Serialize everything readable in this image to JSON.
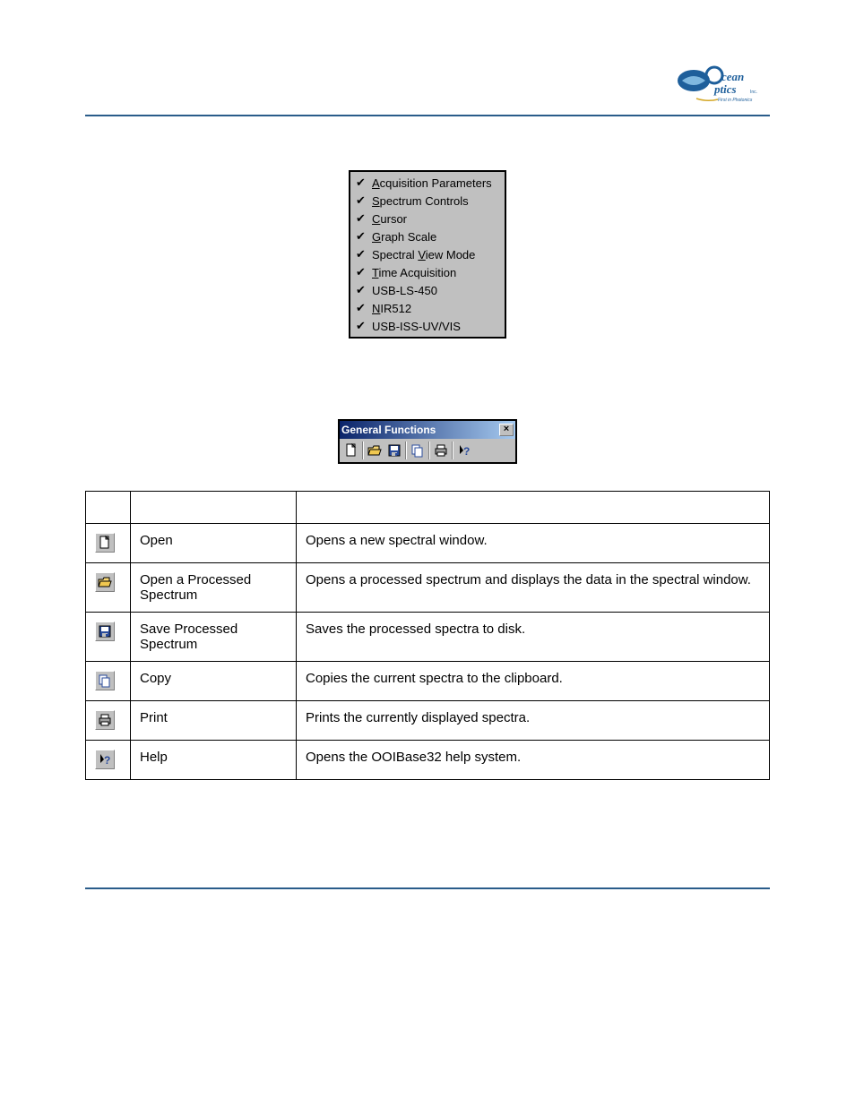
{
  "menu": {
    "items": [
      {
        "prefix": "A",
        "rest": "cquisition Parameters"
      },
      {
        "prefix": "S",
        "rest": "pectrum Controls"
      },
      {
        "prefix": "C",
        "rest": "ursor"
      },
      {
        "prefix": "G",
        "rest": "raph Scale"
      },
      {
        "prefix": "",
        "rest": "Spectral ",
        "mid_u": "V",
        "tail": "iew Mode"
      },
      {
        "prefix": "T",
        "rest": "ime Acquisition"
      },
      {
        "prefix": "",
        "rest": "USB-LS-450"
      },
      {
        "prefix": "N",
        "rest": "IR512"
      },
      {
        "prefix": "",
        "rest": "USB-ISS-UV/VIS"
      }
    ]
  },
  "toolbar": {
    "title": "General Functions"
  },
  "table": {
    "rows": [
      {
        "name": "Open",
        "desc": "Opens a new spectral window."
      },
      {
        "name": "Open a Processed Spectrum",
        "desc": "Opens a processed spectrum and displays the data in the spectral window."
      },
      {
        "name": "Save Processed Spectrum",
        "desc": "Saves the processed spectra to disk."
      },
      {
        "name": "Copy",
        "desc": "Copies the current spectra to the clipboard."
      },
      {
        "name": "Print",
        "desc": "Prints the currently displayed spectra."
      },
      {
        "name": "Help",
        "desc": "Opens the OOIBase32 help system."
      }
    ]
  }
}
